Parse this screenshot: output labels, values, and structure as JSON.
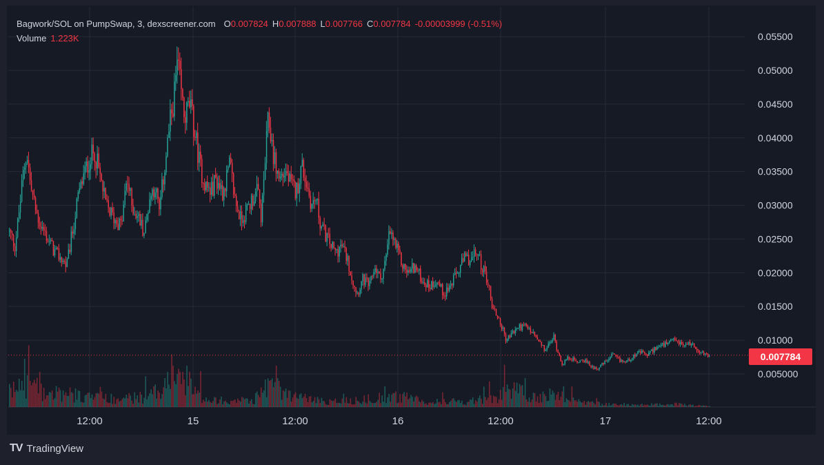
{
  "legend": {
    "symbol": "Bagwork/SOL on PumpSwap, 3, dexscreener.com",
    "o_label": "O",
    "o": "0.007824",
    "h_label": "H",
    "h": "0.007888",
    "l_label": "L",
    "l": "0.007766",
    "c_label": "C",
    "c": "0.007784",
    "change": "-0.00003999 (-0.51%)",
    "volume_label": "Volume",
    "volume": "1.223K"
  },
  "price_tag": "0.007784",
  "brand": {
    "logo": "TV",
    "name": "TradingView"
  },
  "colors": {
    "up": "#26a69a",
    "down": "#f23645",
    "bg": "#161a25",
    "grid": "#262a36",
    "text": "#d1d4dc"
  },
  "chart_data": {
    "type": "candlestick",
    "title": "Bagwork/SOL on PumpSwap, 3, dexscreener.com",
    "ylim": [
      0.003,
      0.056
    ],
    "y_ticks": [
      "0.05500",
      "0.05000",
      "0.04500",
      "0.04000",
      "0.03500",
      "0.03000",
      "0.02500",
      "0.02000",
      "0.01500",
      "0.01000",
      "0.005000"
    ],
    "y_tick_values": [
      0.055,
      0.05,
      0.045,
      0.04,
      0.035,
      0.03,
      0.025,
      0.02,
      0.015,
      0.01,
      0.005
    ],
    "x_ticks": [
      "12:00",
      "15",
      "12:00",
      "16",
      "12:00",
      "17",
      "12:00"
    ],
    "last_price": 0.007784,
    "grid": true,
    "price_path": [
      [
        0,
        0.026
      ],
      [
        0.008,
        0.024
      ],
      [
        0.015,
        0.03
      ],
      [
        0.02,
        0.035
      ],
      [
        0.025,
        0.038
      ],
      [
        0.03,
        0.033
      ],
      [
        0.038,
        0.029
      ],
      [
        0.045,
        0.027
      ],
      [
        0.055,
        0.025
      ],
      [
        0.065,
        0.023
      ],
      [
        0.075,
        0.022
      ],
      [
        0.082,
        0.021
      ],
      [
        0.09,
        0.026
      ],
      [
        0.098,
        0.031
      ],
      [
        0.105,
        0.034
      ],
      [
        0.115,
        0.037
      ],
      [
        0.122,
        0.038
      ],
      [
        0.13,
        0.034
      ],
      [
        0.138,
        0.03
      ],
      [
        0.15,
        0.028
      ],
      [
        0.16,
        0.027
      ],
      [
        0.168,
        0.034
      ],
      [
        0.175,
        0.03
      ],
      [
        0.185,
        0.028
      ],
      [
        0.193,
        0.026
      ],
      [
        0.2,
        0.031
      ],
      [
        0.208,
        0.033
      ],
      [
        0.214,
        0.029
      ],
      [
        0.22,
        0.034
      ],
      [
        0.228,
        0.041
      ],
      [
        0.235,
        0.046
      ],
      [
        0.24,
        0.051
      ],
      [
        0.245,
        0.047
      ],
      [
        0.25,
        0.043
      ],
      [
        0.258,
        0.045
      ],
      [
        0.266,
        0.04
      ],
      [
        0.272,
        0.036
      ],
      [
        0.28,
        0.033
      ],
      [
        0.288,
        0.032
      ],
      [
        0.295,
        0.034
      ],
      [
        0.305,
        0.032
      ],
      [
        0.315,
        0.036
      ],
      [
        0.322,
        0.031
      ],
      [
        0.33,
        0.028
      ],
      [
        0.338,
        0.029
      ],
      [
        0.347,
        0.031
      ],
      [
        0.355,
        0.032
      ],
      [
        0.36,
        0.028
      ],
      [
        0.365,
        0.036
      ],
      [
        0.37,
        0.043
      ],
      [
        0.378,
        0.037
      ],
      [
        0.385,
        0.034
      ],
      [
        0.395,
        0.035
      ],
      [
        0.402,
        0.033
      ],
      [
        0.41,
        0.032
      ],
      [
        0.418,
        0.036
      ],
      [
        0.425,
        0.033
      ],
      [
        0.432,
        0.03
      ],
      [
        0.438,
        0.031
      ],
      [
        0.445,
        0.027
      ],
      [
        0.455,
        0.025
      ],
      [
        0.465,
        0.023
      ],
      [
        0.475,
        0.024
      ],
      [
        0.483,
        0.022
      ],
      [
        0.49,
        0.019
      ],
      [
        0.497,
        0.017
      ],
      [
        0.505,
        0.019
      ],
      [
        0.515,
        0.018
      ],
      [
        0.522,
        0.021
      ],
      [
        0.53,
        0.019
      ],
      [
        0.538,
        0.022
      ],
      [
        0.543,
        0.026
      ],
      [
        0.548,
        0.025
      ],
      [
        0.555,
        0.023
      ],
      [
        0.562,
        0.021
      ],
      [
        0.57,
        0.02
      ],
      [
        0.578,
        0.021
      ],
      [
        0.59,
        0.019
      ],
      [
        0.6,
        0.018
      ],
      [
        0.61,
        0.019
      ],
      [
        0.62,
        0.017
      ],
      [
        0.63,
        0.018
      ],
      [
        0.64,
        0.02
      ],
      [
        0.65,
        0.022
      ],
      [
        0.66,
        0.022
      ],
      [
        0.668,
        0.023
      ],
      [
        0.675,
        0.021
      ],
      [
        0.683,
        0.019
      ],
      [
        0.69,
        0.015
      ],
      [
        0.7,
        0.013
      ],
      [
        0.71,
        0.01
      ],
      [
        0.718,
        0.011
      ],
      [
        0.728,
        0.012
      ],
      [
        0.738,
        0.012
      ],
      [
        0.748,
        0.011
      ],
      [
        0.758,
        0.0095
      ],
      [
        0.765,
        0.0085
      ],
      [
        0.772,
        0.0095
      ],
      [
        0.778,
        0.0105
      ],
      [
        0.783,
        0.0085
      ],
      [
        0.79,
        0.0065
      ],
      [
        0.8,
        0.0075
      ],
      [
        0.81,
        0.0068
      ],
      [
        0.82,
        0.0072
      ],
      [
        0.83,
        0.0062
      ],
      [
        0.84,
        0.0058
      ],
      [
        0.852,
        0.0068
      ],
      [
        0.862,
        0.0078
      ],
      [
        0.872,
        0.007
      ],
      [
        0.882,
        0.0068
      ],
      [
        0.892,
        0.0078
      ],
      [
        0.902,
        0.0082
      ],
      [
        0.912,
        0.0078
      ],
      [
        0.922,
        0.0088
      ],
      [
        0.932,
        0.0092
      ],
      [
        0.942,
        0.0095
      ],
      [
        0.952,
        0.01
      ],
      [
        0.962,
        0.0092
      ],
      [
        0.972,
        0.0096
      ],
      [
        0.982,
        0.0088
      ],
      [
        0.99,
        0.008
      ],
      [
        1.0,
        0.0078
      ]
    ],
    "volume_profile": [
      [
        0,
        0.2
      ],
      [
        0.02,
        0.35
      ],
      [
        0.05,
        0.22
      ],
      [
        0.1,
        0.16
      ],
      [
        0.15,
        0.12
      ],
      [
        0.2,
        0.14
      ],
      [
        0.24,
        0.55
      ],
      [
        0.27,
        0.16
      ],
      [
        0.3,
        0.1
      ],
      [
        0.35,
        0.1
      ],
      [
        0.37,
        0.35
      ],
      [
        0.4,
        0.16
      ],
      [
        0.45,
        0.08
      ],
      [
        0.5,
        0.1
      ],
      [
        0.55,
        0.15
      ],
      [
        0.6,
        0.08
      ],
      [
        0.65,
        0.07
      ],
      [
        0.7,
        0.15
      ],
      [
        0.72,
        0.25
      ],
      [
        0.75,
        0.12
      ],
      [
        0.79,
        0.22
      ],
      [
        0.8,
        0.1
      ],
      [
        0.85,
        0.04
      ],
      [
        0.9,
        0.03
      ],
      [
        0.95,
        0.04
      ],
      [
        1.0,
        0.01
      ]
    ]
  }
}
